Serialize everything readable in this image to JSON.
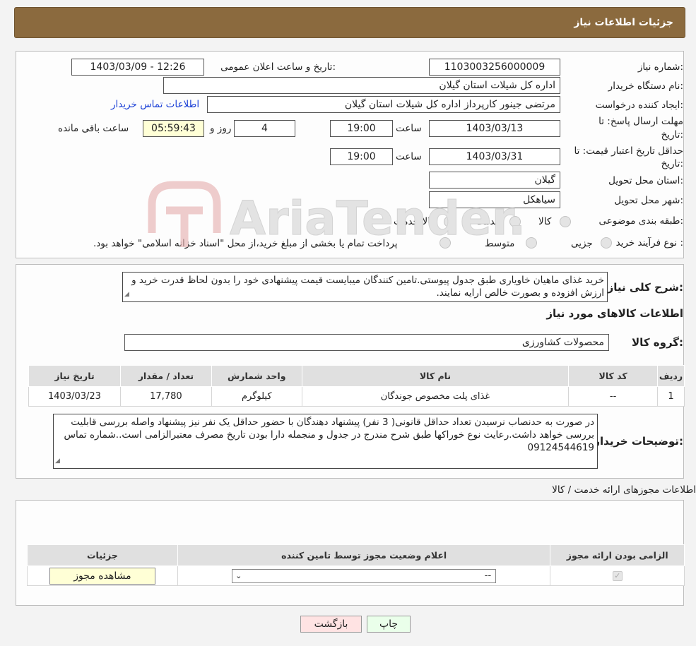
{
  "header": {
    "title": "جزئیات اطلاعات نیاز"
  },
  "info": {
    "need_number_label": "شماره نیاز:",
    "need_number": "1103003256000009",
    "announce_label": "تاریخ و ساعت اعلان عمومی:",
    "announce_value": "1403/03/09 - 12:26",
    "buyer_org_label": "نام دستگاه خریدار:",
    "buyer_org": "اداره کل شیلات استان گیلان",
    "creator_label": "ایجاد کننده درخواست:",
    "creator": "مرتضی جینور کارپرداز اداره کل شیلات استان گیلان",
    "contact_link": "اطلاعات تماس خریدار",
    "deadline_label_1": "مهلت ارسال پاسخ: تا",
    "deadline_label_2": "تاریخ:",
    "deadline_date": "1403/03/13",
    "time_label": "ساعت",
    "deadline_time": "19:00",
    "days_value": "4",
    "days_label": "روز و",
    "remaining_value": "05:59:43",
    "remaining_label": "ساعت باقی مانده",
    "validity_label_1": "حداقل تاریخ اعتبار قیمت: تا",
    "validity_label_2": "تاریخ:",
    "validity_date": "1403/03/31",
    "validity_time": "19:00",
    "province_label": "استان محل تحویل:",
    "province": "گیلان",
    "city_label": "شهر محل تحویل:",
    "city": "سیاهکل",
    "category_label": "طبقه بندی موضوعی:",
    "category_options": [
      "کالا",
      "خدمت",
      "کالا/خدمت"
    ],
    "process_label": "نوع فرآیند خرید :",
    "process_options": [
      "جزیی",
      "متوسط"
    ],
    "process_note": "پرداخت تمام یا بخشی از مبلغ خرید،از محل \"اسناد خزانه اسلامی\" خواهد بود."
  },
  "description": {
    "label": "شرح کلی نیاز:",
    "text": "خرید غذای ماهیان خاویاری طبق جدول پیوستی.تامین کنندگان میبایست قیمت پیشنهادی خود را بدون لحاظ قدرت خرید و ارزش افزوده و بصورت خالص ارایه نمایند."
  },
  "goods": {
    "section_title": "اطلاعات کالاهای مورد نیاز",
    "group_label": "گروه کالا:",
    "group_value": "محصولات کشاورزی",
    "columns": [
      "ردیف",
      "کد کالا",
      "نام کالا",
      "واحد شمارش",
      "تعداد / مقدار",
      "تاریخ نیاز"
    ],
    "rows": [
      [
        "1",
        "--",
        "غذای پلت مخصوص جوندگان",
        "کیلوگرم",
        "17,780",
        "1403/03/23"
      ]
    ],
    "buyer_notes_label": "توضیحات خریدار:",
    "buyer_notes": "در صورت به حدنصاب نرسیدن تعداد حداقل قانونی( 3 نفر) پیشنهاد دهندگان با حضور حداقل یک نفر نیز پیشنهاد واصله بررسی قابلیت بررسی خواهد داشت.رعایت نوع خوراکها طبق شرح مندرج در جدول  و منجمله دارا بودن تاریخ مصرف معتبرالزامی است..شماره تماس 09124544619"
  },
  "permits": {
    "section_title": "اطلاعات مجوزهای ارائه خدمت / کالا",
    "columns": [
      "الزامی بودن ارائه مجوز",
      "اعلام وضعیت مجوز توسط تامین کننده",
      "جزئیات"
    ],
    "select_value": "--",
    "view_button": "مشاهده مجوز"
  },
  "footer": {
    "print_button": "چاپ",
    "back_button": "بازگشت"
  },
  "watermark": {
    "text": "AriaTender.neT"
  }
}
